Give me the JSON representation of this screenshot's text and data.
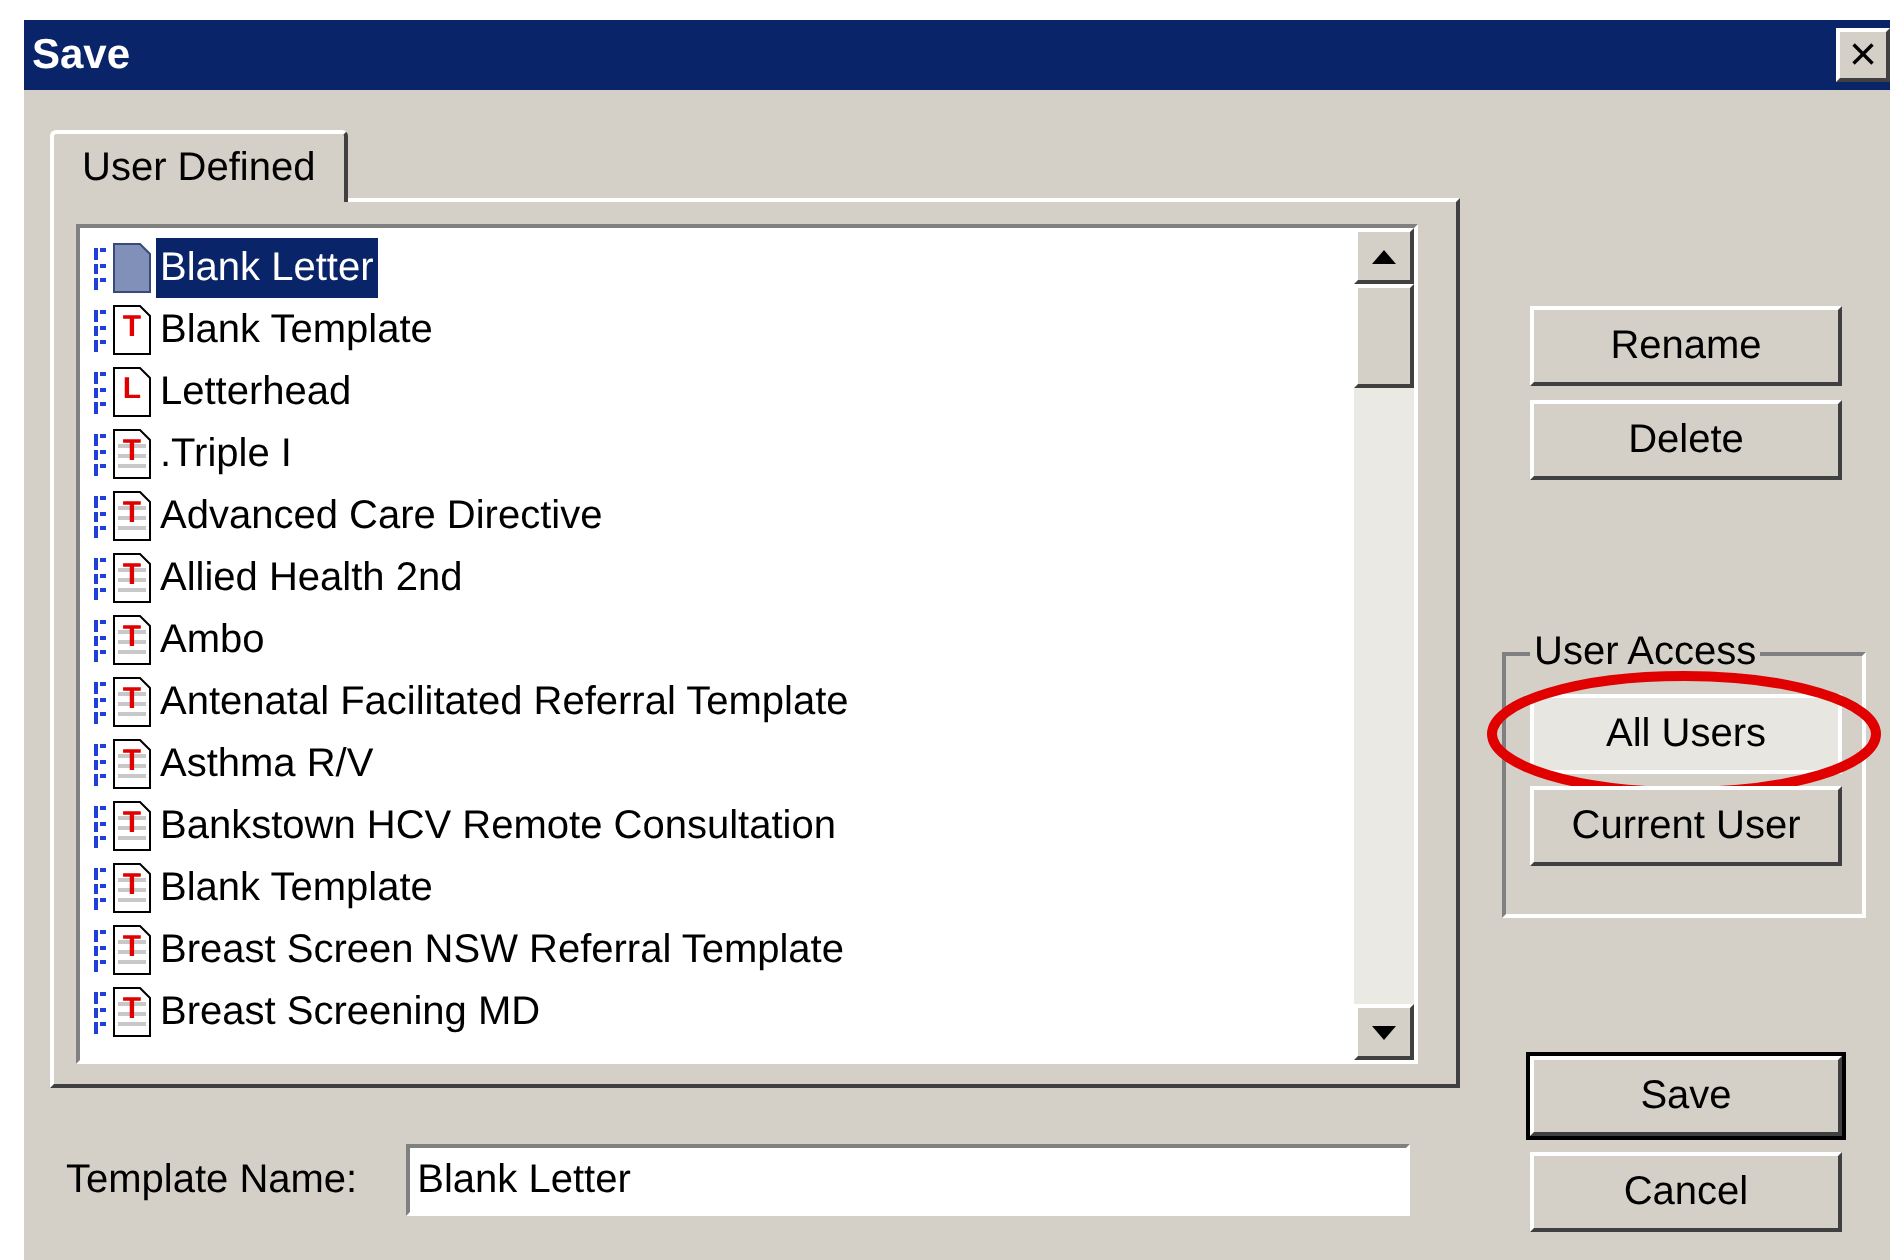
{
  "window": {
    "title": "Save",
    "close": "×"
  },
  "tabs": [
    {
      "label": "User Defined",
      "selected": true
    }
  ],
  "templates": [
    {
      "name": "Blank Letter",
      "kind": "plain",
      "selected": true
    },
    {
      "name": "Blank Template",
      "kind": "template",
      "letter": "T",
      "selected": false
    },
    {
      "name": "Letterhead",
      "kind": "template",
      "letter": "L",
      "selected": false
    },
    {
      "name": ".Triple I",
      "kind": "lined",
      "letter": "T",
      "selected": false
    },
    {
      "name": "Advanced Care Directive",
      "kind": "lined",
      "letter": "T",
      "selected": false
    },
    {
      "name": "Allied Health 2nd",
      "kind": "lined",
      "letter": "T",
      "selected": false
    },
    {
      "name": "Ambo",
      "kind": "lined",
      "letter": "T",
      "selected": false
    },
    {
      "name": "Antenatal Facilitated Referral Template",
      "kind": "lined",
      "letter": "T",
      "selected": false
    },
    {
      "name": "Asthma R/V",
      "kind": "lined",
      "letter": "T",
      "selected": false
    },
    {
      "name": "Bankstown HCV Remote Consultation",
      "kind": "lined",
      "letter": "T",
      "selected": false
    },
    {
      "name": "Blank Template",
      "kind": "lined",
      "letter": "T",
      "selected": false
    },
    {
      "name": "Breast Screen NSW Referral Template",
      "kind": "lined",
      "letter": "T",
      "selected": false
    },
    {
      "name": "Breast Screening MD",
      "kind": "lined",
      "letter": "T",
      "selected": false
    }
  ],
  "actions": [
    {
      "label": "Rename"
    },
    {
      "label": "Delete"
    }
  ],
  "user_access": {
    "label": "User Access",
    "buttons": [
      {
        "label": "All Users",
        "pressed": true,
        "highlighted": true
      },
      {
        "label": "Current User",
        "pressed": false,
        "highlighted": false
      }
    ]
  },
  "dialog_buttons": [
    {
      "label": "Save",
      "default": true
    },
    {
      "label": "Cancel",
      "default": false
    }
  ],
  "template_name": {
    "label": "Template Name:",
    "value": "Blank Letter"
  }
}
